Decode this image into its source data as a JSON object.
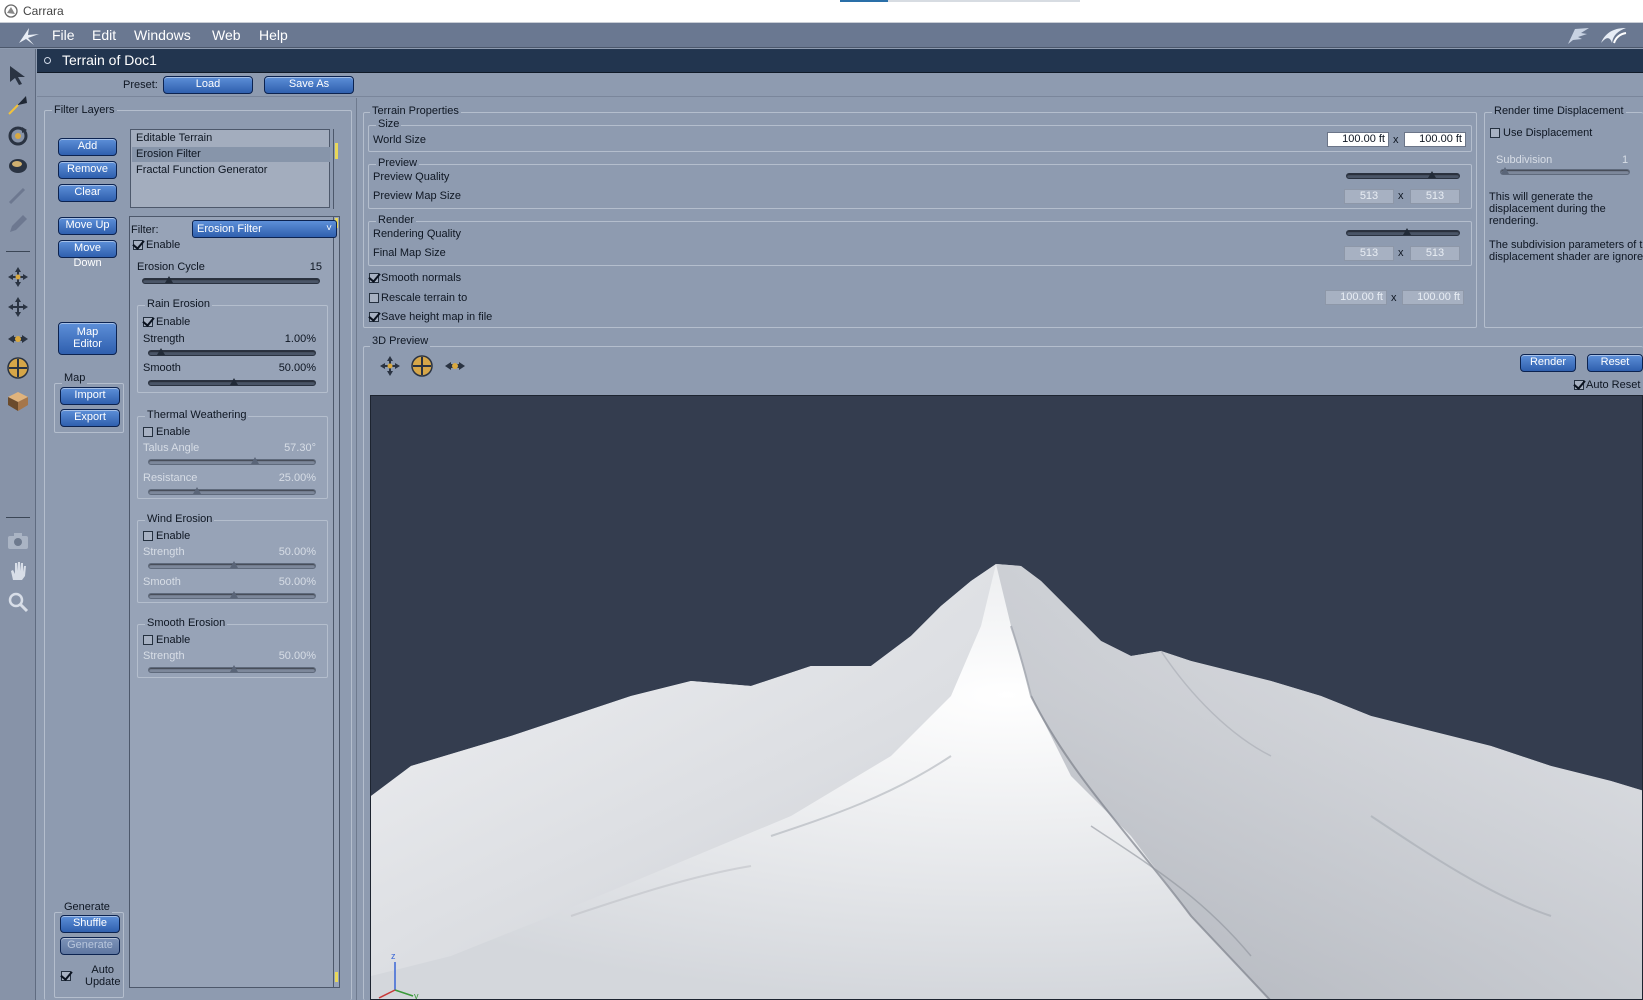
{
  "app": {
    "title": "Carrara",
    "menu": [
      "File",
      "Edit",
      "Windows",
      "Web",
      "Help"
    ]
  },
  "document": {
    "title": "Terrain of Doc1"
  },
  "preset": {
    "label": "Preset:",
    "load": "Load",
    "save_as": "Save As"
  },
  "filter_layers": {
    "title": "Filter Layers",
    "buttons": {
      "add": "Add",
      "remove": "Remove",
      "clear": "Clear",
      "move_up": "Move Up",
      "move_down": "Move Down",
      "map_editor_1": "Map",
      "map_editor_2": "Editor"
    },
    "layers": [
      "Editable Terrain",
      "Erosion Filter",
      "Fractal Function Generator"
    ],
    "selected_layer": 1,
    "map": {
      "title": "Map",
      "import": "Import",
      "export": "Export"
    },
    "generate": {
      "title": "Generate",
      "shuffle": "Shuffle",
      "generate": "Generate",
      "auto_update_1": "Auto",
      "auto_update_2": "Update",
      "auto_update_checked": true
    }
  },
  "filter": {
    "label": "Filter:",
    "selected": "Erosion Filter",
    "enable_label": "Enable",
    "enable_checked": true,
    "erosion_cycle": {
      "label": "Erosion Cycle",
      "value": "15",
      "level": 0.1
    },
    "rain_erosion": {
      "title": "Rain Erosion",
      "enable_label": "Enable",
      "enabled": true,
      "strength": {
        "label": "Strength",
        "value": "1.00%",
        "level": 0.01
      },
      "smooth": {
        "label": "Smooth",
        "value": "50.00%",
        "level": 0.5
      }
    },
    "thermal_weathering": {
      "title": "Thermal Weathering",
      "enable_label": "Enable",
      "enabled": false,
      "talus_angle": {
        "label": "Talus Angle",
        "value": "57.30°",
        "level": 0.64
      },
      "resistance": {
        "label": "Resistance",
        "value": "25.00%",
        "level": 0.25
      }
    },
    "wind_erosion": {
      "title": "Wind Erosion",
      "enable_label": "Enable",
      "enabled": false,
      "strength": {
        "label": "Strength",
        "value": "50.00%",
        "level": 0.5
      },
      "smooth": {
        "label": "Smooth",
        "value": "50.00%",
        "level": 0.5
      }
    },
    "smooth_erosion": {
      "title": "Smooth Erosion",
      "enable_label": "Enable",
      "enabled": false,
      "strength": {
        "label": "Strength",
        "value": "50.00%",
        "level": 0.5
      }
    }
  },
  "terrain_properties": {
    "title": "Terrain Properties",
    "size": {
      "title": "Size",
      "world_size_label": "World Size",
      "world_x": "100.00 ft",
      "world_y": "100.00 ft",
      "x_sep": "x"
    },
    "preview": {
      "title": "Preview",
      "quality_label": "Preview Quality",
      "quality_level": 0.78,
      "map_size_label": "Preview Map Size",
      "map_x": "513",
      "map_y": "513",
      "x_sep": "x"
    },
    "render": {
      "title": "Render",
      "quality_label": "Rendering Quality",
      "quality_level": 0.52,
      "map_size_label": "Final Map Size",
      "map_x": "513",
      "map_y": "513",
      "x_sep": "x"
    },
    "smooth_normals": {
      "label": "Smooth normals",
      "checked": true
    },
    "rescale_terrain": {
      "label": "Rescale terrain to",
      "checked": false,
      "x": "100.00 ft",
      "y": "100.00 ft",
      "x_sep": "x"
    },
    "save_height_map": {
      "label": "Save height map in file",
      "checked": true
    }
  },
  "render_displacement": {
    "title": "Render time Displacement",
    "use_label": "Use Displacement",
    "use_checked": false,
    "subdivision_label": "Subdivision",
    "subdivision_value": "1",
    "info1_a": "This will generate the",
    "info1_b": "displacement during the",
    "info1_c": "rendering.",
    "info2_a": "The subdivision parameters of t",
    "info2_b": "displacement shader are ignore"
  },
  "preview_3d": {
    "title": "3D Preview",
    "render": "Render",
    "reset": "Reset",
    "auto_reset_label": "Auto Reset",
    "auto_reset_checked": true,
    "axis_z": "z",
    "axis_y": "y",
    "background_color": "#343d4f"
  },
  "icons": {
    "toolbar": [
      "pointer-icon",
      "bend-icon",
      "rotate-icon",
      "spin-icon",
      "brush-icon",
      "pen-icon",
      "move-icon",
      "move-xy-icon",
      "move-plane-icon",
      "trackball-icon",
      "terrain-icon",
      "camera-icon",
      "hand-icon",
      "zoom-icon"
    ],
    "preview_tools": [
      "move-icon",
      "trackball-icon",
      "dolly-icon"
    ]
  }
}
